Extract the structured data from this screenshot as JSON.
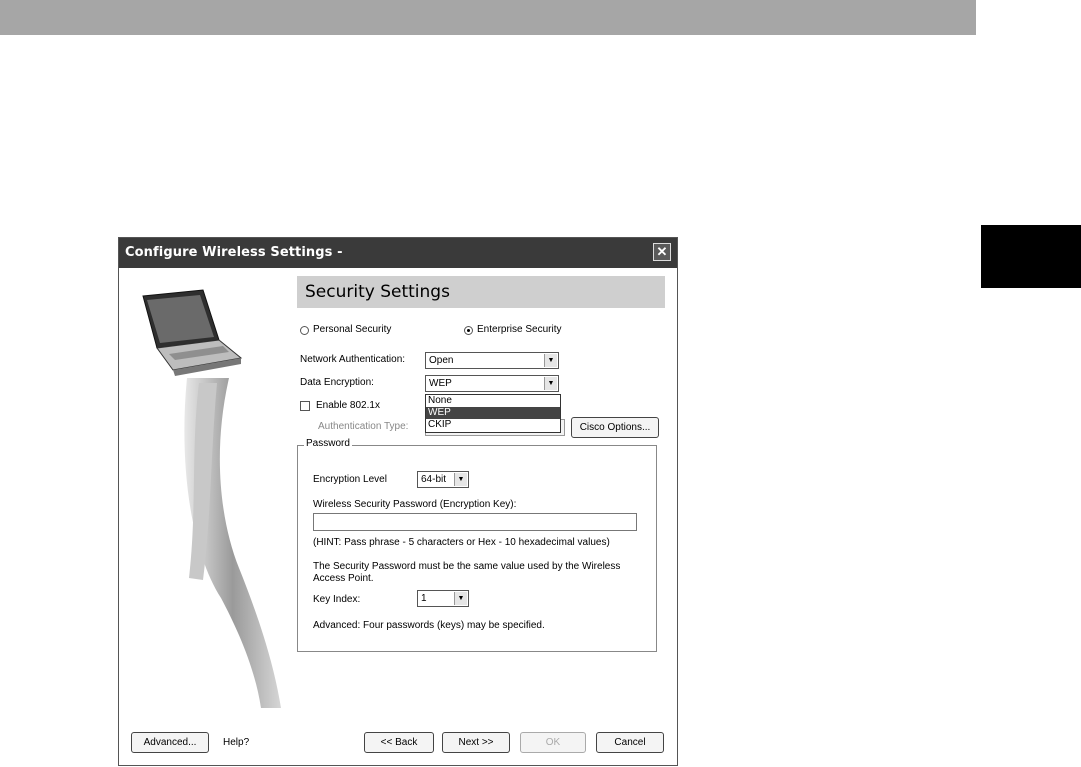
{
  "dialog": {
    "title": "Configure Wireless Settings -",
    "close_glyph": "✕"
  },
  "section": {
    "title": "Security Settings"
  },
  "security_mode": {
    "personal_label": "Personal Security",
    "enterprise_label": "Enterprise Security",
    "selected": "enterprise"
  },
  "network_auth": {
    "label": "Network Authentication:",
    "value": "Open"
  },
  "data_encryption": {
    "label": "Data Encryption:",
    "value": "WEP",
    "options": [
      "None",
      "WEP",
      "CKIP"
    ],
    "highlighted": "WEP"
  },
  "enable_8021x": {
    "label": "Enable 802.1x",
    "checked": false
  },
  "auth_type": {
    "label": "Authentication Type:"
  },
  "cisco_options_label": "Cisco Options...",
  "password_group": {
    "legend": "Password",
    "encryption_level_label": "Encryption Level",
    "encryption_level_value": "64-bit",
    "key_field_label": "Wireless Security Password (Encryption Key):",
    "hint": "(HINT: Pass phrase - 5 characters or Hex - 10 hexadecimal values)",
    "note_line1": "The Security Password must be the same value used by the Wireless",
    "note_line2": "Access Point.",
    "key_index_label": "Key Index:",
    "key_index_value": "1",
    "advanced_note": "Advanced: Four passwords (keys) may be specified."
  },
  "footer": {
    "advanced_label": "Advanced...",
    "help_label": "Help?",
    "back_label": "<< Back",
    "next_label": "Next >>",
    "ok_label": "OK",
    "cancel_label": "Cancel"
  },
  "icons": {
    "dropdown_arrow": "▼"
  }
}
